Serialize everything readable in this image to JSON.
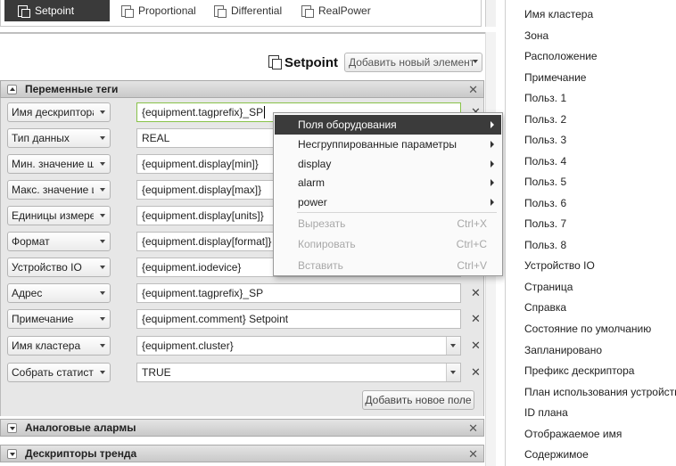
{
  "tabs": [
    {
      "label": "Setpoint",
      "icon": "document-icon",
      "active": true
    },
    {
      "label": "Proportional",
      "icon": "document-icon",
      "active": false
    },
    {
      "label": "Differential",
      "icon": "document-icon",
      "active": false
    },
    {
      "label": "RealPower",
      "icon": "document-icon",
      "active": false
    }
  ],
  "header": {
    "title": "Setpoint",
    "add_element_label": "Добавить новый элемент"
  },
  "sections": {
    "variable_tags": "Переменные теги",
    "analog_alarms": "Аналоговые алармы",
    "trend_tags": "Дескрипторы тренда"
  },
  "rows": [
    {
      "field": "Имя дескриптора",
      "value": "{equipment.tagprefix}_SP",
      "combo": false
    },
    {
      "field": "Тип данных",
      "value": "REAL",
      "combo": false
    },
    {
      "field": "Мин. значение шкалы",
      "value": "{equipment.display[min]}",
      "combo": false
    },
    {
      "field": "Макс. значение шкалы",
      "value": "{equipment.display[max]}",
      "combo": false
    },
    {
      "field": "Единицы измерения",
      "value": "{equipment.display[units]}",
      "combo": false
    },
    {
      "field": "Формат",
      "value": "{equipment.display[format]}",
      "combo": false
    },
    {
      "field": "Устройство IO",
      "value": "{equipment.iodevice}",
      "combo": false
    },
    {
      "field": "Адрес",
      "value": "{equipment.tagprefix}_SP",
      "combo": false
    },
    {
      "field": "Примечание",
      "value": "{equipment.comment} Setpoint",
      "combo": false
    },
    {
      "field": "Имя кластера",
      "value": "{equipment.cluster}",
      "combo": true
    },
    {
      "field": "Собрать статистику",
      "value": "TRUE",
      "combo": true
    }
  ],
  "add_field_label": "Добавить новое поле",
  "context_menu": {
    "items": [
      {
        "label": "Поля оборудования",
        "submenu": true,
        "highlighted": true
      },
      {
        "label": "Несгруппированные параметры",
        "submenu": true
      },
      {
        "label": "display",
        "submenu": true
      },
      {
        "label": "alarm",
        "submenu": true
      },
      {
        "label": "power",
        "submenu": true
      }
    ],
    "edit_items": [
      {
        "label": "Вырезать",
        "shortcut": "Ctrl+X"
      },
      {
        "label": "Копировать",
        "shortcut": "Ctrl+C"
      },
      {
        "label": "Вставить",
        "shortcut": "Ctrl+V"
      }
    ]
  },
  "right_panel": {
    "items": [
      "Имя кластера",
      "Зона",
      "Расположение",
      "Примечание",
      "Польз. 1",
      "Польз. 2",
      "Польз. 3",
      "Польз. 4",
      "Польз. 5",
      "Польз. 6",
      "Польз. 7",
      "Польз. 8",
      "Устройство IO",
      "Страница",
      "Справка",
      "Состояние по умолчанию",
      "Запланировано",
      "Префикс дескриптора",
      "План использования устройства",
      "ID плана",
      "Отображаемое имя",
      "Содержимое"
    ]
  },
  "colors": {
    "active_tab": "#3a3a3a",
    "menu_highlight": "#3b3b3b",
    "focus_border": "#88c24a",
    "section_body": "#e7e7e7"
  }
}
